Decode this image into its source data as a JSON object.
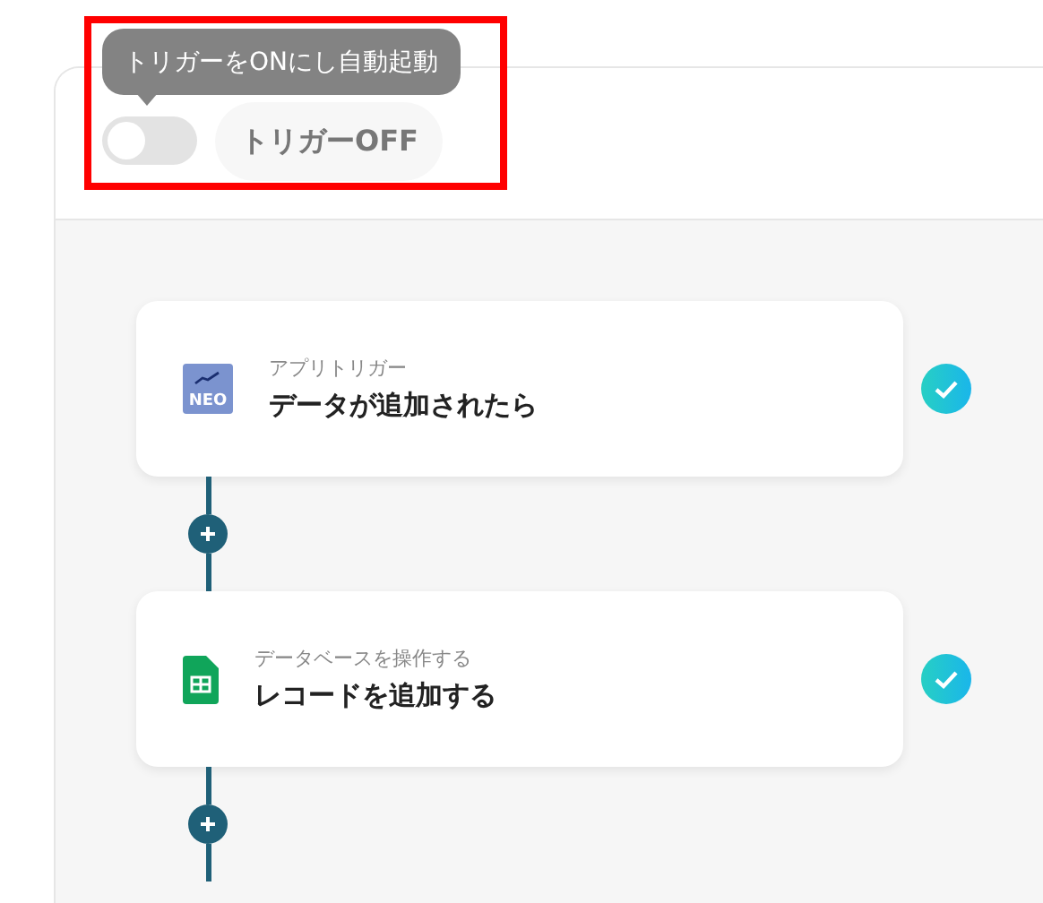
{
  "trigger": {
    "tooltip": "トリガーをONにし自動起動",
    "on": false,
    "label": "トリガーOFF"
  },
  "steps": [
    {
      "category": "アプリトリガー",
      "title": "データが追加されたら",
      "icon": {
        "kind": "neo",
        "text": "NEO"
      },
      "done": true
    },
    {
      "category": "データベースを操作する",
      "title": "レコードを追加する",
      "icon": {
        "kind": "sheet"
      },
      "done": true
    }
  ]
}
